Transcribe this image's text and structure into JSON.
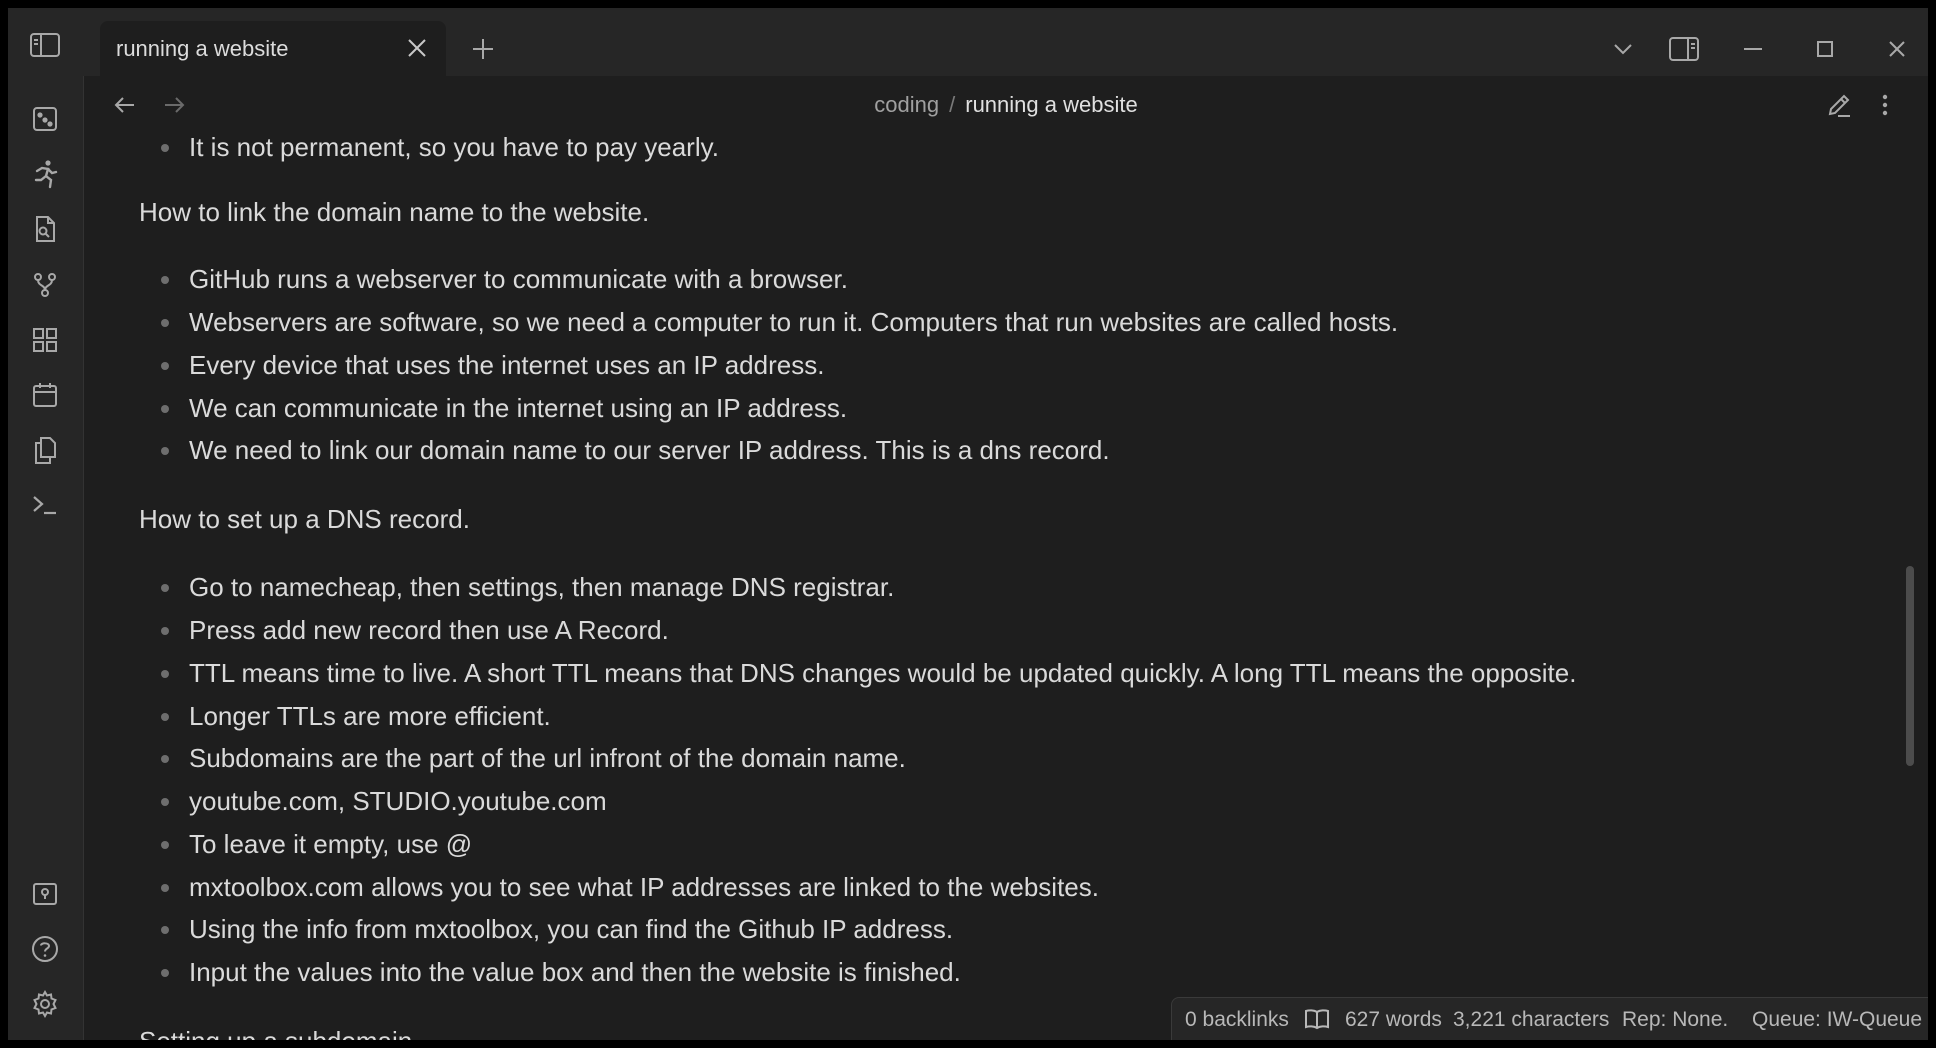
{
  "tab": {
    "title": "running a website"
  },
  "breadcrumb": {
    "parent": "coding",
    "separator": "/",
    "current": "running a website"
  },
  "content": {
    "partial_top": "It is not permanent, so you have to pay yearly.",
    "heading1": "How to link the domain name to the website.",
    "list1": [
      "GitHub runs a webserver to communicate with a browser.",
      "Webservers are software, so we need a computer to run it. Computers that run websites are called hosts.",
      "Every device that uses the internet uses an IP address.",
      "We can communicate in the internet using an IP address.",
      "We need to link our domain name to our server IP address. This is a dns record."
    ],
    "heading2": "How to set up a DNS record.",
    "list2": [
      "Go to namecheap, then settings, then manage DNS registrar.",
      "Press add new record then use A Record.",
      "TTL means time to live. A short TTL means that DNS changes would be updated quickly. A long TTL means the opposite.",
      "Longer TTLs are more efficient.",
      "Subdomains are the part of the url infront of the domain name.",
      "youtube.com, STUDIO.youtube.com",
      "To leave it empty, use @",
      "mxtoolbox.com allows you to see what IP addresses are linked to the websites.",
      "Using the info from mxtoolbox, you can find the Github IP address.",
      "Input the values into the value box and then the website is finished."
    ],
    "partial_bottom": "Setting up a subdomain"
  },
  "status": {
    "backlinks": "0 backlinks",
    "words": "627 words",
    "characters": "3,221 characters",
    "rep": "Rep: None.",
    "queue": "Queue: IW-Queue"
  },
  "icons": {
    "ribbon_top": [
      "graph-view-icon",
      "run-icon",
      "file-search-icon",
      "git-branch-icon",
      "dashboard-grid-icon",
      "calendar-icon",
      "copy-pages-icon",
      "terminal-icon"
    ],
    "ribbon_bottom": [
      "vault-switcher-icon",
      "help-icon",
      "settings-icon"
    ]
  },
  "colors": {
    "background": "#1e1e1e",
    "chrome": "#262626",
    "text": "#dadada",
    "muted": "#a0a0a0"
  }
}
